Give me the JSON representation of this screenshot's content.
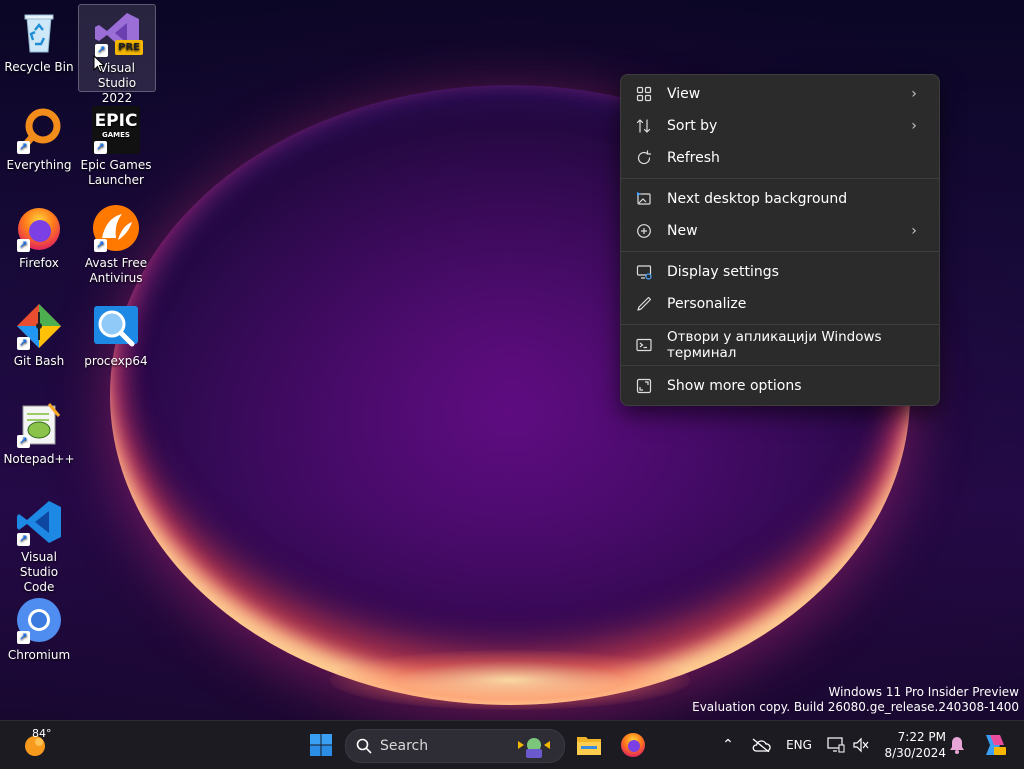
{
  "desktop_icons": [
    {
      "name": "recycle-bin",
      "label": "Recycle Bin"
    },
    {
      "name": "visual-studio-2022-preview",
      "label": "Visual Studio 2022 Preview",
      "badge": "PRE"
    },
    {
      "name": "everything",
      "label": "Everything"
    },
    {
      "name": "epic-games-launcher",
      "label": "Epic Games Launcher",
      "logo_top": "EPIC",
      "logo_bottom": "GAMES"
    },
    {
      "name": "firefox",
      "label": "Firefox"
    },
    {
      "name": "avast-free-antivirus",
      "label": "Avast Free Antivirus"
    },
    {
      "name": "git-bash",
      "label": "Git Bash"
    },
    {
      "name": "procexp64",
      "label": "procexp64"
    },
    {
      "name": "notepad-plus-plus",
      "label": "Notepad++"
    },
    {
      "name": "visual-studio-code",
      "label": "Visual Studio Code"
    },
    {
      "name": "chromium",
      "label": "Chromium"
    }
  ],
  "context_menu": {
    "items": [
      {
        "label": "View",
        "icon": "grid-icon",
        "submenu": true
      },
      {
        "label": "Sort by",
        "icon": "sort-icon",
        "submenu": true
      },
      {
        "label": "Refresh",
        "icon": "refresh-icon",
        "submenu": false
      },
      {
        "label": "Next desktop background",
        "icon": "image-next-icon",
        "submenu": false
      },
      {
        "label": "New",
        "icon": "plus-circle-icon",
        "submenu": true
      },
      {
        "label": "Display settings",
        "icon": "display-settings-icon",
        "submenu": false
      },
      {
        "label": "Personalize",
        "icon": "pen-icon",
        "submenu": false
      },
      {
        "label": "Отвори у апликацији Windows терминал",
        "icon": "terminal-icon",
        "submenu": false
      },
      {
        "label": "Show more options",
        "icon": "expand-icon",
        "submenu": false
      }
    ]
  },
  "watermark": {
    "line1": "Windows 11 Pro Insider Preview",
    "line2": "Evaluation copy. Build 26080.ge_release.240308-1400"
  },
  "taskbar": {
    "weather_temp": "84°",
    "search_label": "Search",
    "language": "ENG",
    "time": "7:22 PM",
    "date": "8/30/2024"
  },
  "colors": {
    "menu_bg": "#2b2b2b",
    "taskbar_bg": "#1c1b22",
    "accent": "#0078d4"
  }
}
